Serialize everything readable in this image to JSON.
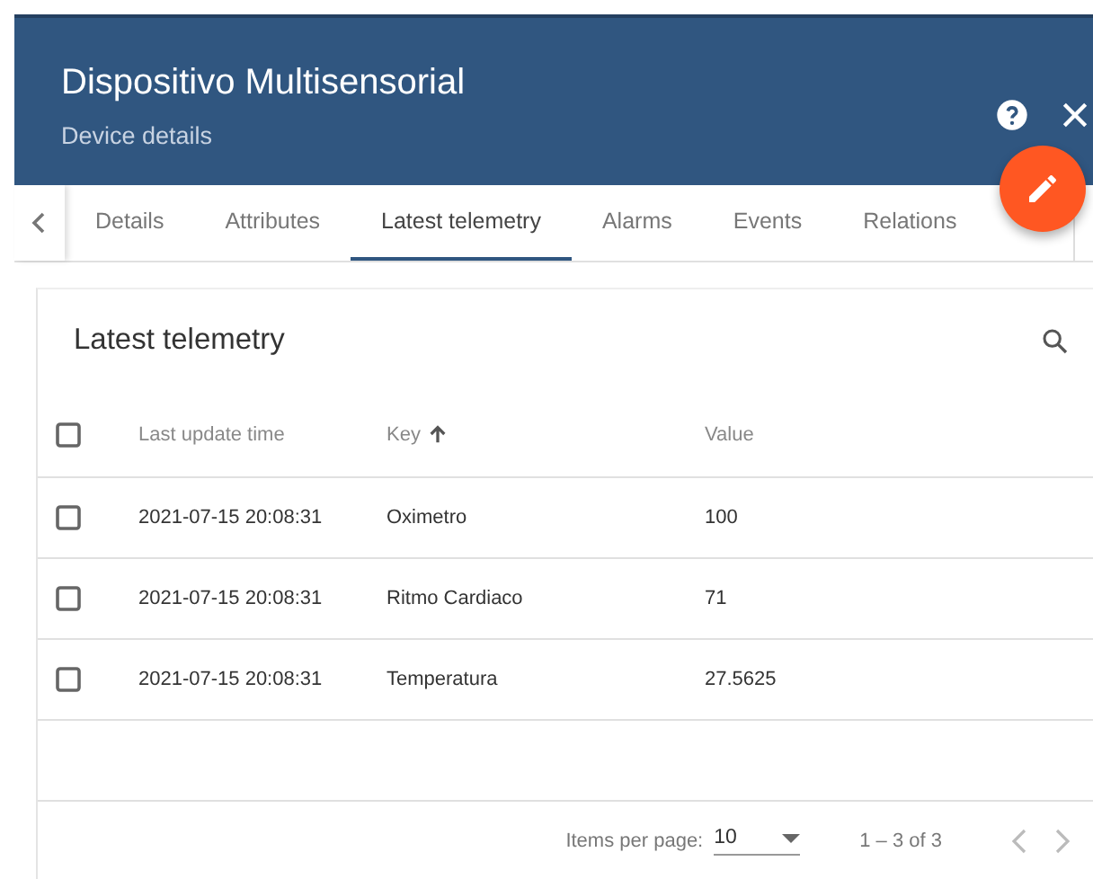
{
  "header": {
    "title": "Dispositivo Multisensorial",
    "subtitle": "Device details"
  },
  "tabs": [
    {
      "label": "Details",
      "selected": false
    },
    {
      "label": "Attributes",
      "selected": false
    },
    {
      "label": "Latest telemetry",
      "selected": true
    },
    {
      "label": "Alarms",
      "selected": false
    },
    {
      "label": "Events",
      "selected": false
    },
    {
      "label": "Relations",
      "selected": false
    }
  ],
  "card": {
    "title": "Latest telemetry"
  },
  "table": {
    "columns": [
      {
        "label": "Last update time",
        "sorted": false
      },
      {
        "label": "Key",
        "sorted": true
      },
      {
        "label": "Value",
        "sorted": false
      }
    ],
    "all_checked": false,
    "rows": [
      {
        "checked": false,
        "cells": [
          "2021-07-15 20:08:31",
          "Oximetro",
          "100"
        ]
      },
      {
        "checked": false,
        "cells": [
          "2021-07-15 20:08:31",
          "Ritmo Cardiaco",
          "71"
        ]
      },
      {
        "checked": false,
        "cells": [
          "2021-07-15 20:08:31",
          "Temperatura",
          "27.5625"
        ]
      }
    ]
  },
  "pagination": {
    "label": "Items per page:",
    "page_size": "10",
    "range": "1 – 3 of 3",
    "prev_disabled": true,
    "next_disabled": true
  }
}
